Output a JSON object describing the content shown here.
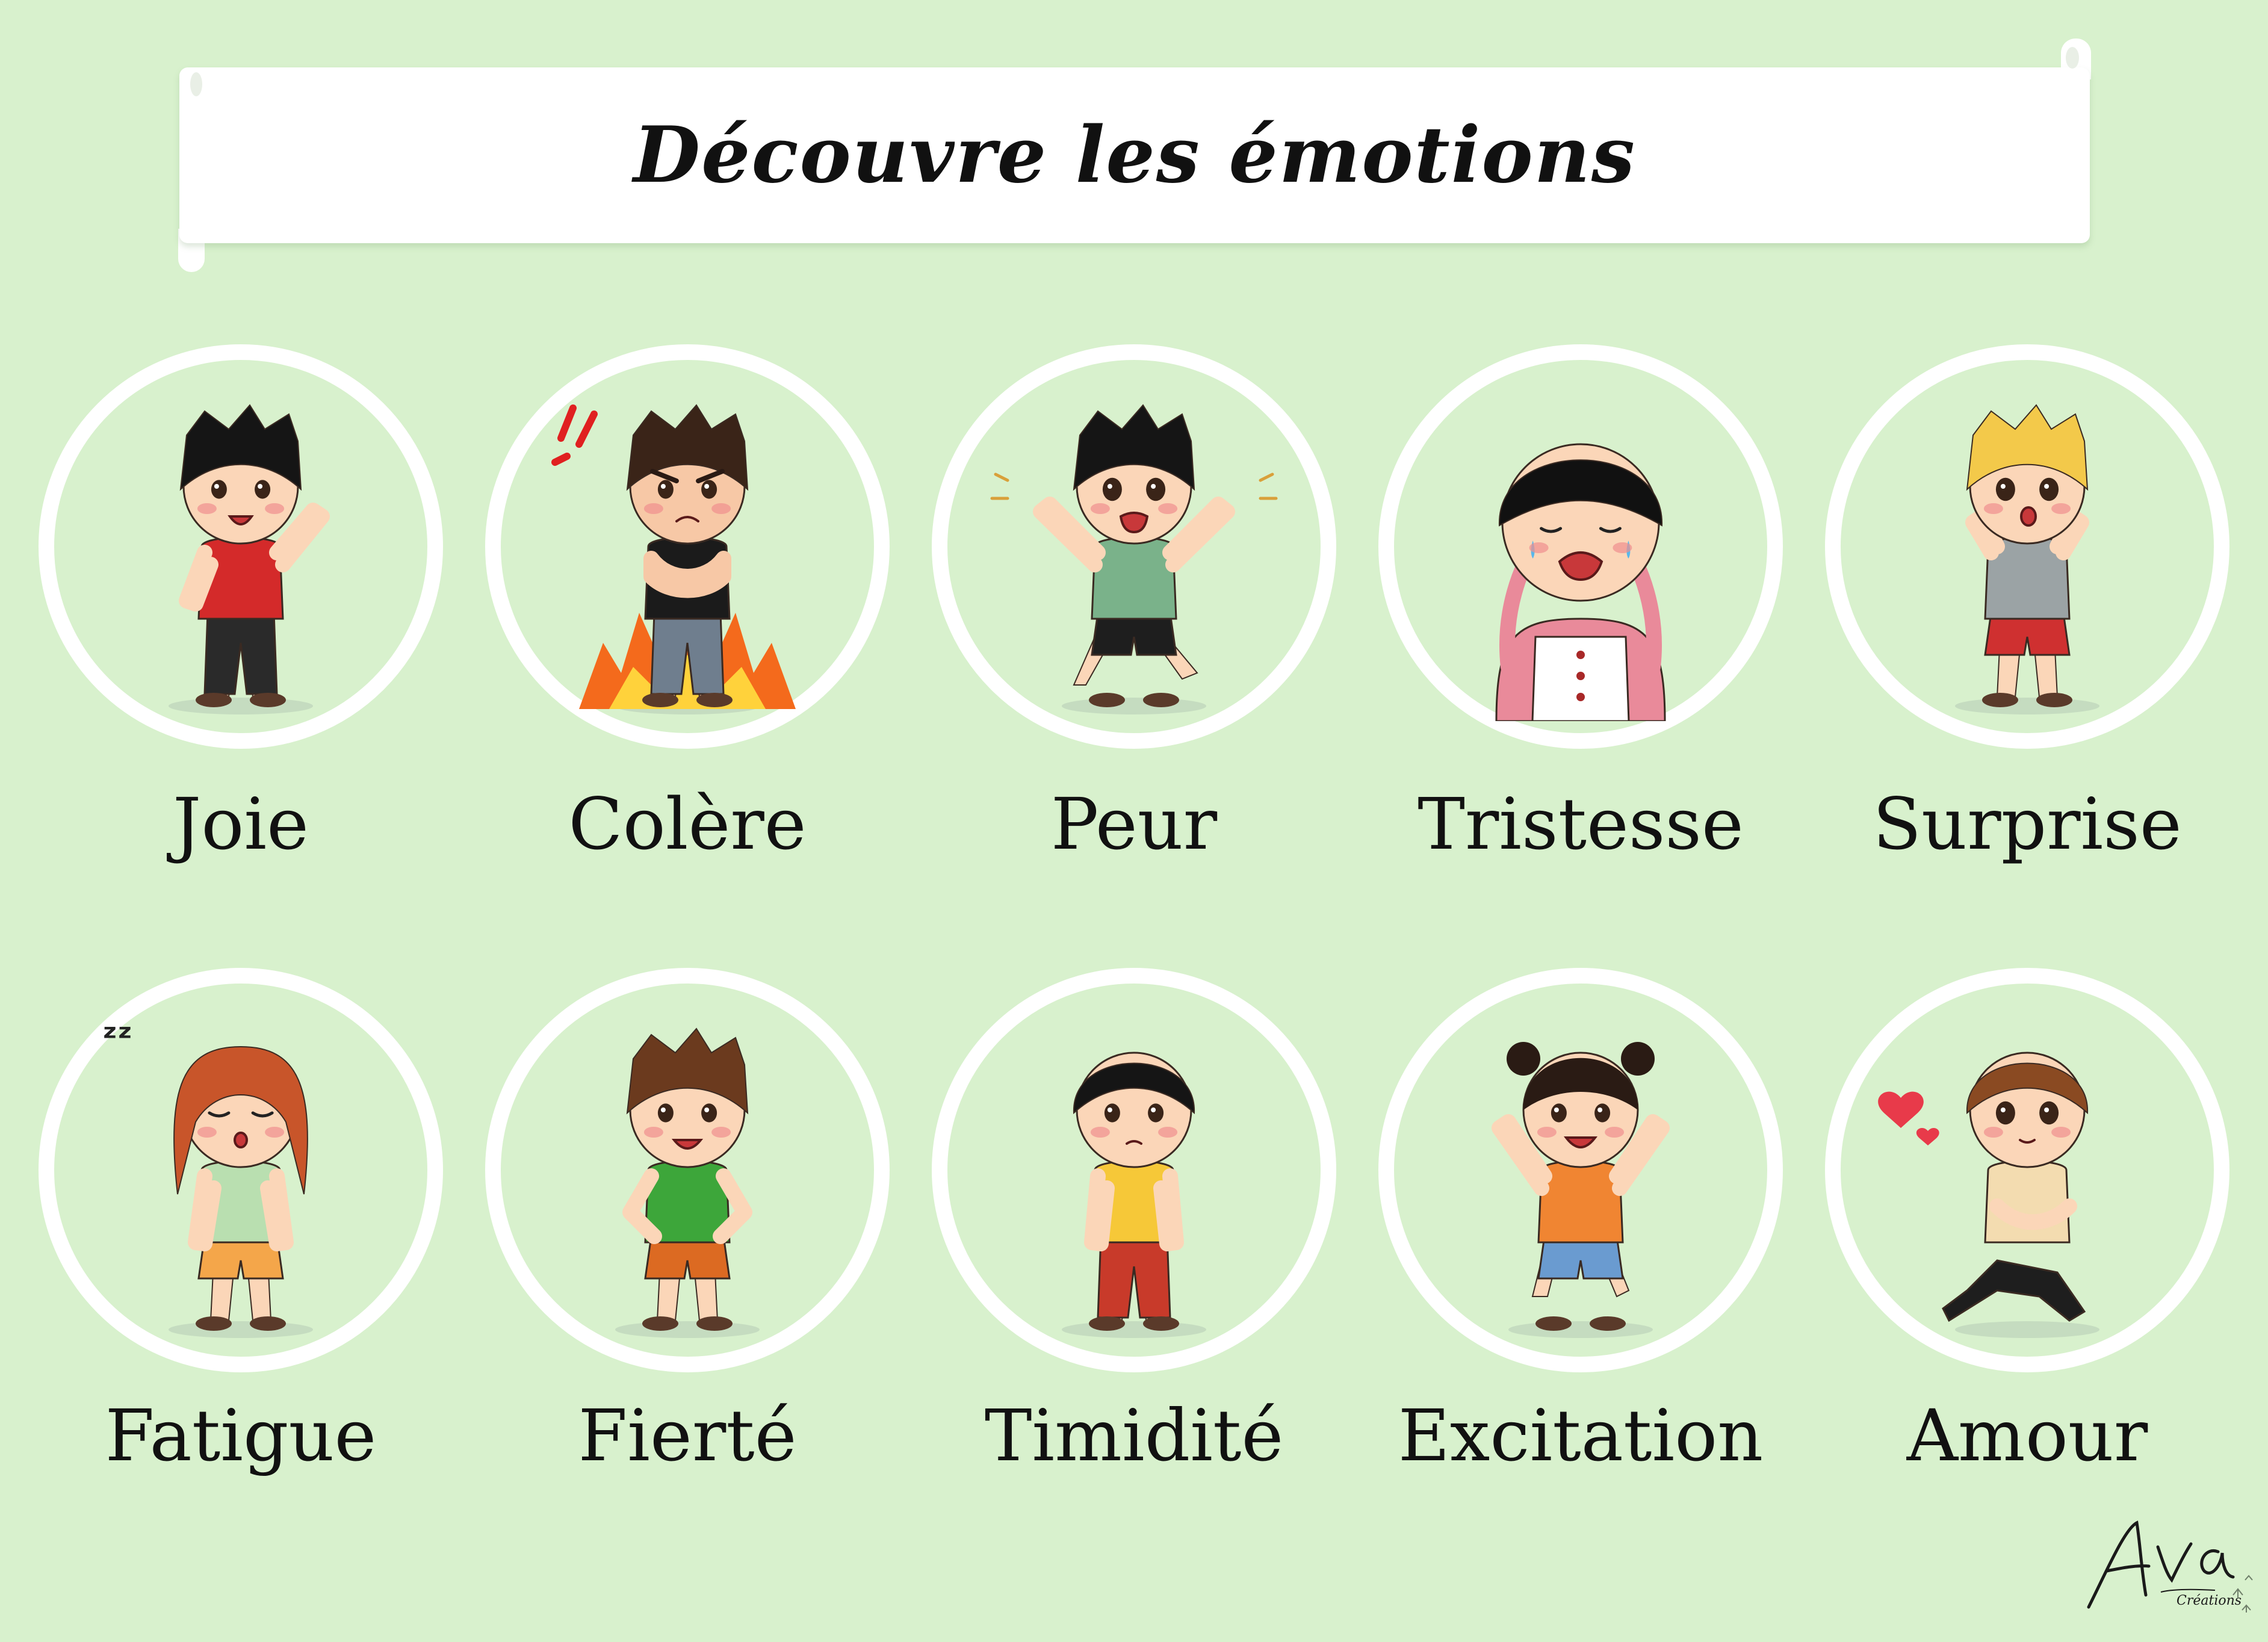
{
  "title": "Découvre les émotions",
  "emotions": [
    {
      "label": "Joie",
      "hair": "#151515",
      "shirt": "#d42a2a",
      "pants": "#2a2a2a",
      "skin": "#fbd6b8",
      "mood": "joy"
    },
    {
      "label": "Colère",
      "hair": "#3a2418",
      "shirt": "#1b1b1b",
      "pants": "#6f7e8e",
      "skin": "#f7c8a6",
      "mood": "anger"
    },
    {
      "label": "Peur",
      "hair": "#151515",
      "shirt": "#7ab28a",
      "pants": "#1e1e1e",
      "skin": "#fbd6b8",
      "mood": "fear"
    },
    {
      "label": "Tristesse",
      "hair": "#111111",
      "shirt": "#e98a9a",
      "pants": "#ffffff",
      "skin": "#fbd6b8",
      "mood": "sad"
    },
    {
      "label": "Surprise",
      "hair": "#f3c94a",
      "shirt": "#9ba3a5",
      "pants": "#cf3030",
      "skin": "#fbd6b8",
      "mood": "surprise"
    },
    {
      "label": "Fatigue",
      "hair": "#c8552a",
      "shirt": "#b9dfb0",
      "pants": "#f4a64a",
      "skin": "#fbd6b8",
      "mood": "tired"
    },
    {
      "label": "Fierté",
      "hair": "#6b3a1e",
      "shirt": "#3da63a",
      "pants": "#dc6a22",
      "skin": "#fbd6b8",
      "mood": "proud"
    },
    {
      "label": "Timidité",
      "hair": "#151515",
      "shirt": "#f6c838",
      "pants": "#c83a2a",
      "skin": "#fbd6b8",
      "mood": "shy"
    },
    {
      "label": "Excitation",
      "hair": "#2a1b14",
      "shirt": "#f08532",
      "pants": "#6a9bd0",
      "skin": "#fbd6b8",
      "mood": "excited"
    },
    {
      "label": "Amour",
      "hair": "#8a4a22",
      "shirt": "#f3dcb0",
      "pants": "#1e1e1e",
      "skin": "#fbd6b8",
      "mood": "love"
    }
  ],
  "signature": {
    "name": "Ava",
    "sub": "Créations"
  }
}
